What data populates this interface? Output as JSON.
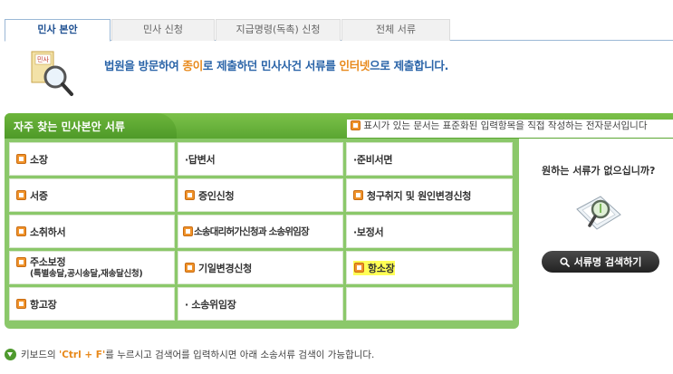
{
  "tabs": [
    {
      "label": "민사 본안",
      "active": true
    },
    {
      "label": "민사 신청",
      "active": false
    },
    {
      "label": "지급명령(독촉) 신청",
      "active": false
    },
    {
      "label": "전체 서류",
      "active": false
    }
  ],
  "banner": {
    "icon_label": "민사",
    "text_before": "법원을 방문하여 ",
    "text_paper": "종이",
    "text_middle": "로 제출하던 민사사건 서류를 ",
    "text_internet": "인터넷",
    "text_after": "으로 제출합니다."
  },
  "list": {
    "title": "자주 찾는 민사본안 서류",
    "legend": "표시가 있는 문서는 표준화된 입력항목을 직접 작성하는 전자문서입니다"
  },
  "documents": [
    {
      "label": "소장",
      "electronic": true
    },
    {
      "label": "·답변서",
      "electronic": false
    },
    {
      "label": "·준비서면",
      "electronic": false
    },
    {
      "label": "서증",
      "electronic": true
    },
    {
      "label": "증인신청",
      "electronic": true
    },
    {
      "label": "청구취지 및 원인변경신청",
      "electronic": true
    },
    {
      "label": "소취하서",
      "electronic": true
    },
    {
      "label": "소송대리허가신청과 소송위임장",
      "electronic": true
    },
    {
      "label": "·보정서",
      "electronic": false
    },
    {
      "label": "주소보정",
      "sublabel": "(특별송달,공시송달,재송달신청)",
      "electronic": true
    },
    {
      "label": "기일변경신청",
      "electronic": true
    },
    {
      "label": "항소장",
      "electronic": true,
      "highlighted": true
    },
    {
      "label": "항고장",
      "electronic": true
    },
    {
      "label": "· 소송위임장",
      "electronic": false
    }
  ],
  "side": {
    "question": "원하는 서류가 없으십니까?",
    "search_button": "서류명 검색하기"
  },
  "footer": {
    "text_before": "키보드의 ",
    "key": "'Ctrl + F'",
    "text_after": "를 누르시고 검색어를 입력하시면 아래 소송서류 검색이 가능합니다."
  },
  "colors": {
    "accent_green": "#5aa631",
    "title_blue": "#2a64a8",
    "highlight_orange": "#e8891b",
    "highlight_yellow": "#ffff55"
  }
}
